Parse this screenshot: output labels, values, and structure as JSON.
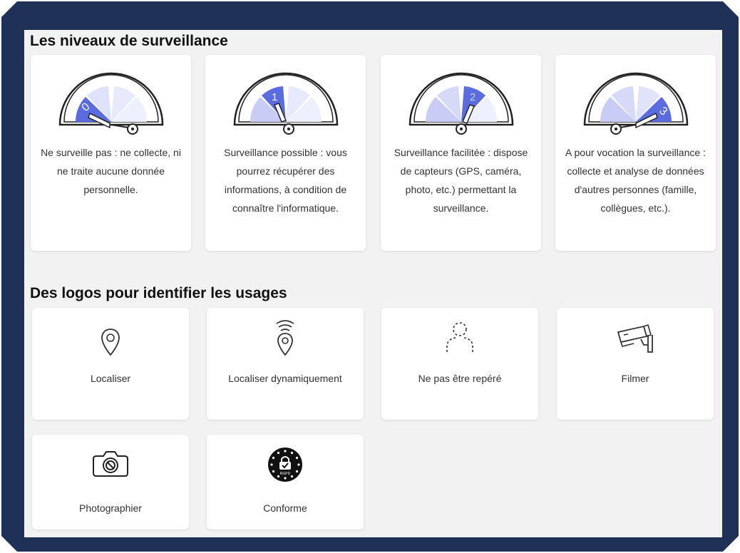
{
  "section_levels": {
    "title": "Les niveaux de surveillance",
    "levels": [
      {
        "number": "0",
        "text": "Ne surveille pas : ne collecte, ni ne traite aucune donnée personnelle."
      },
      {
        "number": "1",
        "text": "Surveillance possible : vous pourrez récupérer des informations, à condition de connaître l'informatique."
      },
      {
        "number": "2",
        "text": "Surveillance facilitée : dispose de capteurs (GPS, caméra, photo, etc.) permettant la surveillance."
      },
      {
        "number": "3",
        "text": "A pour vocation la surveillance : collecte et analyse de données d'autres personnes (famille, collègues, etc.)."
      }
    ]
  },
  "section_logos": {
    "title": "Des logos pour identifier les usages",
    "logos": [
      {
        "icon": "location-pin-icon",
        "label": "Localiser"
      },
      {
        "icon": "dynamic-location-icon",
        "label": "Localiser dynamiquement"
      },
      {
        "icon": "hidden-person-icon",
        "label": "Ne pas être repéré"
      },
      {
        "icon": "cctv-camera-icon",
        "label": "Filmer"
      },
      {
        "icon": "camera-icon",
        "label": "Photographier"
      },
      {
        "icon": "rgpd-badge-icon",
        "label": "Conforme",
        "badge_text": "RGPD"
      }
    ]
  },
  "colors": {
    "frame": "#1f3157",
    "panel": "#f2f2f2",
    "active_segment": "#5b6be0",
    "inactive_segment": "#dfe2fb"
  }
}
